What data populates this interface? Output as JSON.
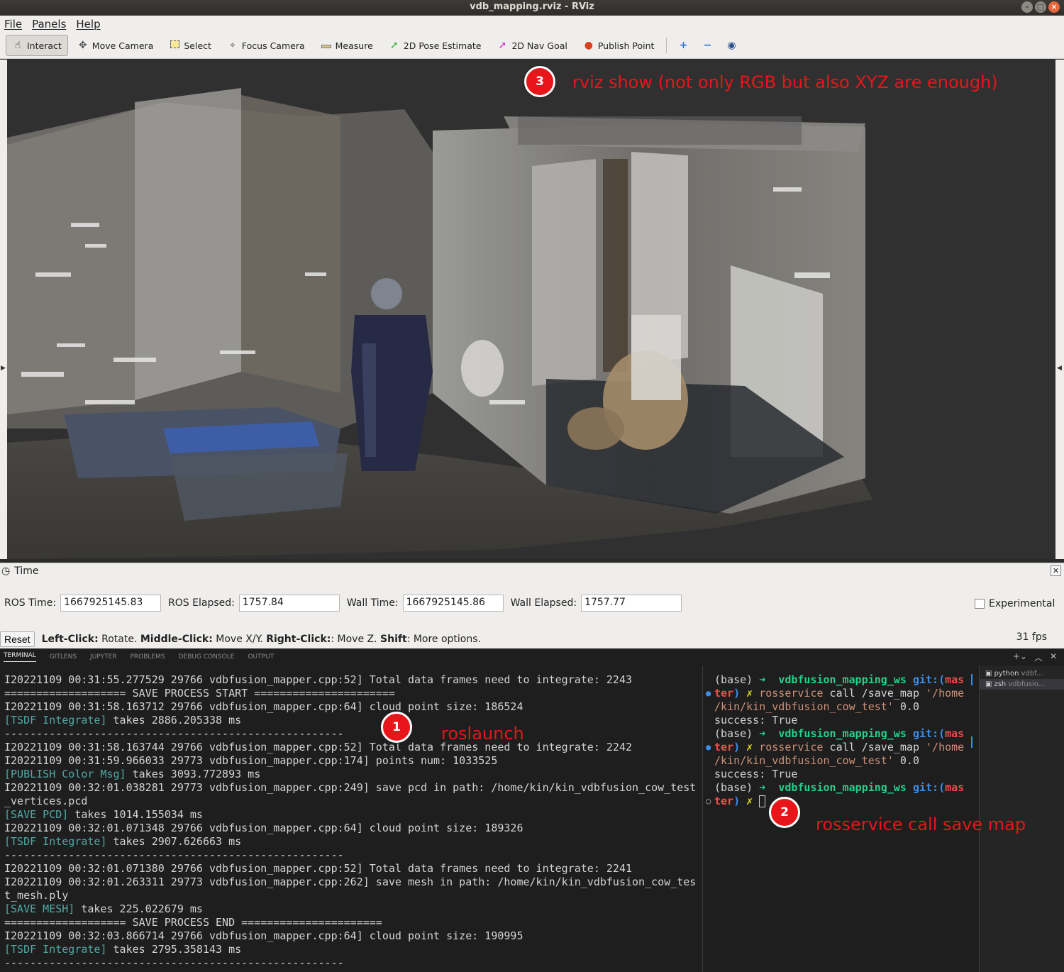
{
  "window": {
    "title": "vdb_mapping.rviz - RViz"
  },
  "menu": [
    "File",
    "Panels",
    "Help"
  ],
  "toolbar": {
    "tools": [
      {
        "label": "Interact",
        "icon": "hand-icon",
        "active": true
      },
      {
        "label": "Move Camera",
        "icon": "move-camera-icon"
      },
      {
        "label": "Select",
        "icon": "select-icon"
      },
      {
        "label": "Focus Camera",
        "icon": "focus-camera-icon"
      },
      {
        "label": "Measure",
        "icon": "ruler-icon"
      },
      {
        "label": "2D Pose Estimate",
        "icon": "pose-arrow-icon"
      },
      {
        "label": "2D Nav Goal",
        "icon": "goal-arrow-icon"
      },
      {
        "label": "Publish Point",
        "icon": "map-pin-icon"
      }
    ]
  },
  "annotations": {
    "a1": {
      "num": "1",
      "text": "roslaunch"
    },
    "a2": {
      "num": "2",
      "text": "rosservice call save map"
    },
    "a3": {
      "num": "3",
      "text": "rviz show (not only RGB but also XYZ are enough)"
    }
  },
  "time_panel": {
    "title": "Time",
    "ros_time_label": "ROS Time:",
    "ros_time": "1667925145.83",
    "ros_elapsed_label": "ROS Elapsed:",
    "ros_elapsed": "1757.84",
    "wall_time_label": "Wall Time:",
    "wall_time": "1667925145.86",
    "wall_elapsed_label": "Wall Elapsed:",
    "wall_elapsed": "1757.77",
    "experimental_label": "Experimental"
  },
  "status": {
    "reset": "Reset",
    "left_click": "Left-Click:",
    "left_click_desc": " Rotate. ",
    "middle_click": "Middle-Click:",
    "middle_click_desc": " Move X/Y. ",
    "right_click": "Right-Click:",
    "right_click_desc": ": Move Z. ",
    "shift": "Shift",
    "shift_desc": ": More options.",
    "fps": "31 fps"
  },
  "terminal_tabs": [
    "TERMINAL",
    "GITLENS",
    "JUPYTER",
    "PROBLEMS",
    "DEBUG CONSOLE",
    "OUTPUT"
  ],
  "terminal_left": [
    {
      "t": "I20221109 00:31:55.277529 29766 vdbfusion_mapper.cpp:52] Total data frames need to integrate: 2243"
    },
    {
      "t": "=================== SAVE PROCESS START ======================"
    },
    {
      "t": "I20221109 00:31:58.163712 29766 vdbfusion_mapper.cpp:64] cloud point size: 186524"
    },
    {
      "tag": "[TSDF Integrate]",
      "t": " takes 2886.205338 ms"
    },
    {
      "t": "-----------------------------------------------------"
    },
    {
      "t": "I20221109 00:31:58.163744 29766 vdbfusion_mapper.cpp:52] Total data frames need to integrate: 2242"
    },
    {
      "t": "I20221109 00:31:59.966033 29773 vdbfusion_mapper.cpp:174] points num: 1033525"
    },
    {
      "tag": "[PUBLISH Color Msg]",
      "t": " takes 3093.772893 ms"
    },
    {
      "t": "I20221109 00:32:01.038281 29773 vdbfusion_mapper.cpp:249] save pcd in path: /home/kin/kin_vdbfusion_cow_test"
    },
    {
      "t": "_vertices.pcd"
    },
    {
      "tag": "[SAVE PCD]",
      "t": " takes 1014.155034 ms"
    },
    {
      "t": "I20221109 00:32:01.071348 29766 vdbfusion_mapper.cpp:64] cloud point size: 189326"
    },
    {
      "tag": "[TSDF Integrate]",
      "t": " takes 2907.626663 ms"
    },
    {
      "t": "-----------------------------------------------------"
    },
    {
      "t": "I20221109 00:32:01.071380 29766 vdbfusion_mapper.cpp:52] Total data frames need to integrate: 2241"
    },
    {
      "t": "I20221109 00:32:01.263311 29773 vdbfusion_mapper.cpp:262] save mesh in path: /home/kin/kin_vdbfusion_cow_tes"
    },
    {
      "t": "t_mesh.ply"
    },
    {
      "tag": "[SAVE MESH]",
      "t": " takes 225.022679 ms"
    },
    {
      "t": "=================== SAVE PROCESS END ======================"
    },
    {
      "t": "I20221109 00:32:03.866714 29766 vdbfusion_mapper.cpp:64] cloud point size: 190995"
    },
    {
      "tag": "[TSDF Integrate]",
      "t": " takes 2795.358143 ms"
    },
    {
      "t": "-----------------------------------------------------"
    }
  ],
  "terminal_right": {
    "env": "(base)",
    "arrow": "➜",
    "ws": "vdbfusion_mapping_ws",
    "git": "git:(",
    "branch_a": "mas",
    "branch_b": "ter",
    "close": ")",
    "x": "✗",
    "cmd": "rosservice",
    "cmd_rest": " call /save_map ",
    "path_a": "'/home",
    "path_b": "/kin/kin_vdbfusion_cow_test'",
    "arg": " 0.0",
    "success": "success: True"
  },
  "terminal_sessions": [
    {
      "name": "python",
      "detail": "vdbf..."
    },
    {
      "name": "zsh",
      "detail": "vdbfusio..."
    }
  ],
  "colors": {
    "annotation": "#e8151a",
    "tag": "#4fa8a3",
    "prompt_green": "#23d18b",
    "git_blue": "#3b8eea"
  }
}
